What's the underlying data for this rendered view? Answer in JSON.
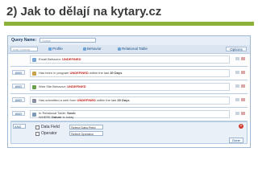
{
  "slide": {
    "title": "2) Jak to dělají na kytary.cz"
  },
  "query": {
    "label": "Query Name:",
    "value": "Guitar"
  },
  "toolbar": {
    "criteria_placeholder": "Add Criteria",
    "profile": "Profile",
    "behavior": "Behavior",
    "relational": "Relational Table",
    "options": "Options"
  },
  "criteria": [
    {
      "op": "",
      "prefix": "Email Behavior:",
      "highlight": "UNDEFINED",
      "suffix": "",
      "icon_color": "#7aa6d6"
    },
    {
      "op": "AND",
      "prefix": "Has been in program",
      "highlight": "UNDEFINED",
      "suffix": "within the last",
      "bold": "30 Days",
      "icon_color": "#c9a34b"
    },
    {
      "op": "AND",
      "prefix": "Web Site Behavior:",
      "highlight": "UNDEFINED",
      "suffix": "",
      "icon_color": "#6a9f4b"
    },
    {
      "op": "AND",
      "prefix": "Has submitted a web form",
      "highlight": "UNDEFINED",
      "suffix": "within the last",
      "bold": "30 Days",
      "icon_color": "#8a8fa0"
    },
    {
      "op": "AND",
      "prefix": "In Relational Table:",
      "bold": "Sweb",
      "line2_prefix": "WHERE",
      "line2_bold": "Datum",
      "line2_suffix": "is today",
      "icon_color": "#7c9ab8"
    }
  ],
  "editor": {
    "op": "AND",
    "data_field_label": "Data Field",
    "data_field_value": "Select Data Field",
    "operator_label": "Operator",
    "operator_value": "Select Operator",
    "remove": "×",
    "done": "Done"
  }
}
